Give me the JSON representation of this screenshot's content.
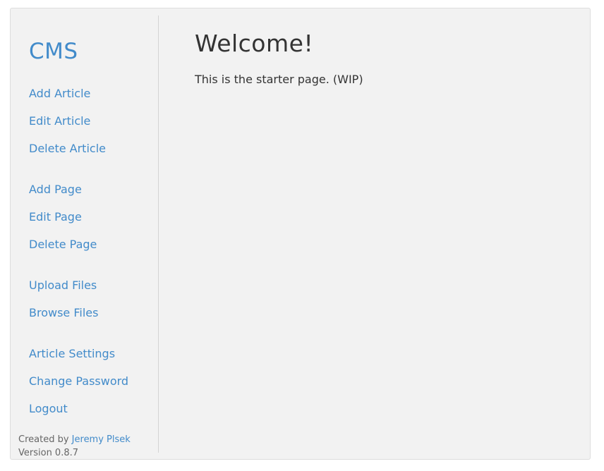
{
  "sidebar": {
    "brand": "CMS",
    "nav": {
      "add_article": "Add Article",
      "edit_article": "Edit Article",
      "delete_article": "Delete Article",
      "add_page": "Add Page",
      "edit_page": "Edit Page",
      "delete_page": "Delete Page",
      "upload_files": "Upload Files",
      "browse_files": "Browse Files",
      "article_settings": "Article Settings",
      "change_password": "Change Password",
      "logout": "Logout"
    },
    "footer": {
      "created_by_label": "Created by",
      "author": "Jeremy Plsek",
      "version": "Version 0.8.7"
    }
  },
  "main": {
    "title": "Welcome!",
    "text": "This is the starter page. (WIP)"
  },
  "colors": {
    "link": "#428bca",
    "text": "#333333",
    "background": "#f2f2f2"
  }
}
